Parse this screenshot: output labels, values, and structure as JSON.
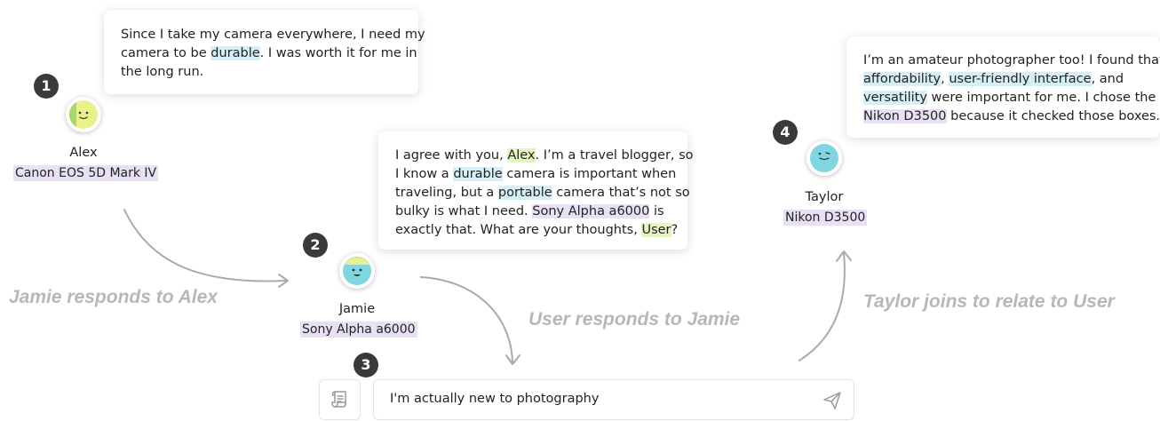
{
  "participants": [
    {
      "name": "Alex",
      "camera": "Canon EOS 5D Mark IV",
      "step": "1"
    },
    {
      "name": "Jamie",
      "camera": "Sony Alpha a6000",
      "step": "2"
    },
    {
      "name": "Taylor",
      "camera": "Nikon D3500",
      "step": "4"
    }
  ],
  "user_step": "3",
  "messages": {
    "alex": {
      "l1": "Since I take my camera everywhere, I need my",
      "l2a": "camera to be ",
      "l2b": "durable",
      "l2c": ". I was worth it for me in",
      "l3": "the long run."
    },
    "jamie": {
      "l1a": "I agree with you, ",
      "l1b": "Alex",
      "l1c": ". I’m a travel blogger, so",
      "l2a": "I know a ",
      "l2b": "durable",
      "l2c": " camera is important when",
      "l3a": "traveling, but a ",
      "l3b": "portable",
      "l3c": " camera that’s not so",
      "l4a": "bulky is what I need. ",
      "l4b": "Sony Alpha a6000",
      "l4c": " is",
      "l5a": "exactly that. What are your thoughts, ",
      "l5b": "User",
      "l5c": "?"
    },
    "taylor": {
      "l1": "I’m an amateur photographer too! I found that",
      "l2a": "affordability",
      "l2b": ", ",
      "l2c": "user-friendly interface",
      "l2d": ", and",
      "l3a": "versatility",
      "l3b": " were important for me. I chose the",
      "l4a": "Nikon D3500",
      "l4b": " because it checked those boxes."
    }
  },
  "captions": {
    "jamie_responds": "Jamie responds to Alex",
    "user_responds": "User responds to Jamie",
    "taylor_joins": "Taylor joins to relate to User"
  },
  "input": {
    "value": "I'm actually new to photography",
    "send_icon": "send-icon",
    "scroll_icon": "scroll-icon"
  },
  "colors": {
    "highlight_attribute": "#d6eef5",
    "highlight_name": "#e4f5c2",
    "highlight_camera": "#e8e0f4",
    "avatar_yellow": "#eaf08a",
    "avatar_cyan": "#7fd6e0",
    "badge": "#3a3a3a",
    "caption": "#b7b7b7"
  }
}
